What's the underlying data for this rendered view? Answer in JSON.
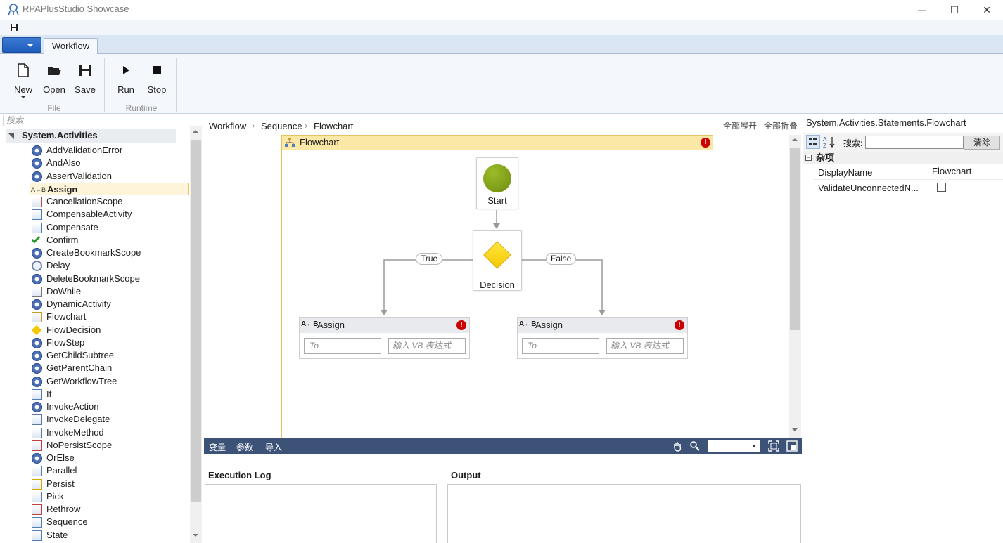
{
  "window": {
    "title": "RPAPlusStudio Showcase",
    "minimize": "—",
    "maximize": "☐",
    "close": "✕"
  },
  "ribbon": {
    "tab": "Workflow",
    "groups": [
      {
        "label": "File",
        "buttons": [
          "New",
          "Open",
          "Save"
        ]
      },
      {
        "label": "Runtime",
        "buttons": [
          "Run",
          "Stop"
        ]
      }
    ]
  },
  "toolbox": {
    "search_placeholder": "搜索",
    "category": "System.Activities",
    "items": [
      {
        "label": "AddValidationError",
        "icon": "gear-icon"
      },
      {
        "label": "AndAlso",
        "icon": "gear-icon"
      },
      {
        "label": "AssertValidation",
        "icon": "gear-icon"
      },
      {
        "label": "Assign",
        "icon": "assign-icon",
        "selected": true
      },
      {
        "label": "CancellationScope",
        "icon": "cancellation-icon"
      },
      {
        "label": "CompensableActivity",
        "icon": "compensable-icon"
      },
      {
        "label": "Compensate",
        "icon": "compensate-icon"
      },
      {
        "label": "Confirm",
        "icon": "check-icon"
      },
      {
        "label": "CreateBookmarkScope",
        "icon": "gear-icon"
      },
      {
        "label": "Delay",
        "icon": "clock-icon"
      },
      {
        "label": "DeleteBookmarkScope",
        "icon": "gear-icon"
      },
      {
        "label": "DoWhile",
        "icon": "loop-icon"
      },
      {
        "label": "DynamicActivity",
        "icon": "gear-icon"
      },
      {
        "label": "Flowchart",
        "icon": "flowchart-icon"
      },
      {
        "label": "FlowDecision",
        "icon": "diamond-icon"
      },
      {
        "label": "FlowStep",
        "icon": "gear-icon"
      },
      {
        "label": "GetChildSubtree",
        "icon": "gear-icon"
      },
      {
        "label": "GetParentChain",
        "icon": "gear-icon"
      },
      {
        "label": "GetWorkflowTree",
        "icon": "gear-icon"
      },
      {
        "label": "If",
        "icon": "if-icon"
      },
      {
        "label": "InvokeAction",
        "icon": "gear-icon"
      },
      {
        "label": "InvokeDelegate",
        "icon": "invoke-icon"
      },
      {
        "label": "InvokeMethod",
        "icon": "invoke-icon"
      },
      {
        "label": "NoPersistScope",
        "icon": "nopersist-icon"
      },
      {
        "label": "OrElse",
        "icon": "gear-icon"
      },
      {
        "label": "Parallel",
        "icon": "parallel-icon"
      },
      {
        "label": "Persist",
        "icon": "persist-icon"
      },
      {
        "label": "Pick",
        "icon": "pick-icon"
      },
      {
        "label": "Rethrow",
        "icon": "rethrow-icon"
      },
      {
        "label": "Sequence",
        "icon": "sequence-icon"
      },
      {
        "label": "State",
        "icon": "state-icon"
      }
    ]
  },
  "breadcrumb": [
    "Workflow",
    "Sequence",
    "Flowchart"
  ],
  "breadcrumb_sep": "›",
  "designer_actions": {
    "expand_all": "全部展开",
    "collapse_all": "全部折叠"
  },
  "flowchart": {
    "title": "Flowchart",
    "error_glyph": "!",
    "start_label": "Start",
    "decision_label": "Decision",
    "true_label": "True",
    "false_label": "False",
    "assign_left": {
      "title": "Assign",
      "to_placeholder": "To",
      "eq": "=",
      "value_placeholder": "输入 VB 表达式"
    },
    "assign_right": {
      "title": "Assign",
      "to_placeholder": "To",
      "eq": "=",
      "value_placeholder": "输入 VB 表达式"
    }
  },
  "designer_tabs": [
    "变量",
    "参数",
    "导入"
  ],
  "bottom": {
    "execution_log": "Execution Log",
    "output": "Output"
  },
  "properties": {
    "title": "System.Activities.Statements.Flowchart",
    "search_label": "搜索:",
    "clear_button": "清除",
    "category": "杂项",
    "rows": [
      {
        "name": "DisplayName",
        "value": "Flowchart"
      },
      {
        "name": "ValidateUnconnectedN...",
        "value": ""
      }
    ]
  },
  "colors": {
    "accent": "#3d5277",
    "flowchart_header": "#fbe7a6",
    "start_node": "#7a9a1a",
    "decision_node": "#ffd700",
    "error": "#cc0000"
  }
}
